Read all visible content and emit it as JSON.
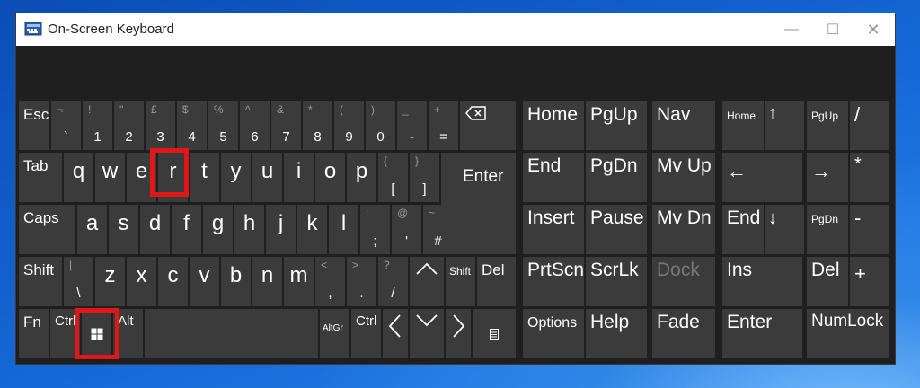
{
  "window": {
    "title": "On-Screen Keyboard",
    "controls": {
      "minimize": "—",
      "maximize": "☐",
      "close": "✕"
    }
  },
  "colors": {
    "key": "#3b3b3b",
    "background": "#1f1f1f",
    "highlight": "#e11616",
    "disabled_text": "#777777"
  },
  "keys": {
    "esc": "Esc",
    "backtick": {
      "shift": "¬",
      "base": "`"
    },
    "d1": {
      "shift": "!",
      "base": "1"
    },
    "d2": {
      "shift": "\"",
      "base": "2"
    },
    "d3": {
      "shift": "£",
      "base": "3"
    },
    "d4": {
      "shift": "$",
      "base": "4"
    },
    "d5": {
      "shift": "%",
      "base": "5"
    },
    "d6": {
      "shift": "^",
      "base": "6"
    },
    "d7": {
      "shift": "&",
      "base": "7"
    },
    "d8": {
      "shift": "*",
      "base": "8"
    },
    "d9": {
      "shift": "(",
      "base": "9"
    },
    "d0": {
      "shift": ")",
      "base": "0"
    },
    "minus": {
      "shift": "_",
      "base": "-"
    },
    "equals": {
      "shift": "+",
      "base": "="
    },
    "tab": "Tab",
    "q": "q",
    "w": "w",
    "e": "e",
    "r": "r",
    "t": "t",
    "y": "y",
    "u": "u",
    "i": "i",
    "o": "o",
    "p": "p",
    "lbracket": {
      "shift": "{",
      "base": "["
    },
    "rbracket": {
      "shift": "}",
      "base": "]"
    },
    "enter": "Enter",
    "caps": "Caps",
    "a": "a",
    "s": "s",
    "d": "d",
    "f": "f",
    "g": "g",
    "h": "h",
    "j": "j",
    "k": "k",
    "l": "l",
    "semicolon": {
      "shift": ":",
      "base": ";"
    },
    "quote": {
      "shift": "@",
      "base": "'"
    },
    "hash": {
      "shift": "~",
      "base": "#"
    },
    "shift_left": "Shift",
    "backslash": {
      "shift": "|",
      "base": "\\"
    },
    "z": "z",
    "x": "x",
    "c": "c",
    "v": "v",
    "b": "b",
    "n": "n",
    "m": "m",
    "comma": {
      "shift": "<",
      "base": ","
    },
    "period": {
      "shift": ">",
      "base": "."
    },
    "slash": {
      "shift": "?",
      "base": "/"
    },
    "shift_right": "Shift",
    "del": "Del",
    "fn": "Fn",
    "ctrl_left": "Ctrl",
    "alt": "Alt",
    "altgr": "AltGr",
    "ctrl_right": "Ctrl",
    "left": "〈",
    "right": "〉",
    "home": "Home",
    "pgup": "PgUp",
    "nav": "Nav",
    "end": "End",
    "pgdn": "PgDn",
    "mvup": "Mv Up",
    "insert": "Insert",
    "pause": "Pause",
    "mvdn": "Mv Dn",
    "prtscn": "PrtScn",
    "scrlk": "ScrLk",
    "dock": "Dock",
    "options": "Options",
    "help": "Help",
    "fade": "Fade",
    "np_home": "Home",
    "np_up": "↑",
    "np_pgup": "PgUp",
    "np_slash": "/",
    "np_left": "←",
    "np_right": "→",
    "np_star": "*",
    "np_end": "End",
    "np_down": "↓",
    "np_pgdn": "PgDn",
    "np_minus": "-",
    "np_ins": "Ins",
    "np_del": "Del",
    "np_plus": "+",
    "np_enter": "Enter",
    "numlock": "NumLock"
  },
  "highlighted_keys": [
    "r",
    "windows"
  ]
}
